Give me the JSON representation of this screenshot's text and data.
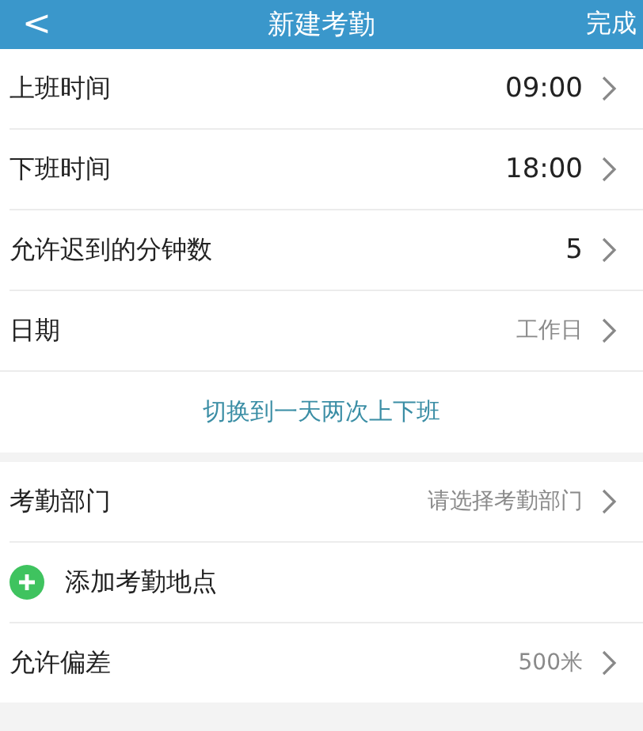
{
  "header": {
    "back": "<",
    "title": "新建考勤",
    "action": "完成"
  },
  "sections": [
    {
      "rows": [
        {
          "kind": "select",
          "label": "上班时间",
          "value": "09:00",
          "muted": false
        },
        {
          "kind": "select",
          "label": "下班时间",
          "value": "18:00",
          "muted": false
        },
        {
          "kind": "select",
          "label": "允许迟到的分钟数",
          "value": "5",
          "muted": false
        },
        {
          "kind": "select",
          "label": "日期",
          "value": "工作日",
          "muted": true
        }
      ],
      "link": "切换到一天两次上下班"
    },
    {
      "rows": [
        {
          "kind": "select",
          "label": "考勤部门",
          "value": "请选择考勤部门",
          "muted": true
        },
        {
          "kind": "add",
          "label": "添加考勤地点"
        },
        {
          "kind": "select",
          "label": "允许偏差",
          "value": "500米",
          "muted": true
        }
      ]
    }
  ]
}
